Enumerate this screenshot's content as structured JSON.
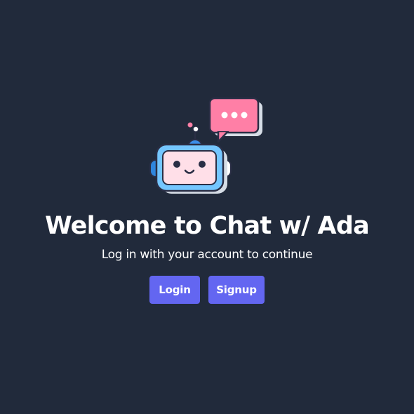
{
  "hero": {
    "illustration": "robot-with-chat-bubble-icon"
  },
  "welcome": {
    "title": "Welcome to Chat w/ Ada",
    "subtitle": "Log in with your account to continue"
  },
  "actions": {
    "login_label": "Login",
    "signup_label": "Signup"
  },
  "colors": {
    "background": "#212a3b",
    "button": "#6366f1",
    "text": "#ffffff",
    "bubble": "#ff7fa6",
    "robot_frame": "#74c6ff",
    "robot_face": "#ffdfe8"
  }
}
